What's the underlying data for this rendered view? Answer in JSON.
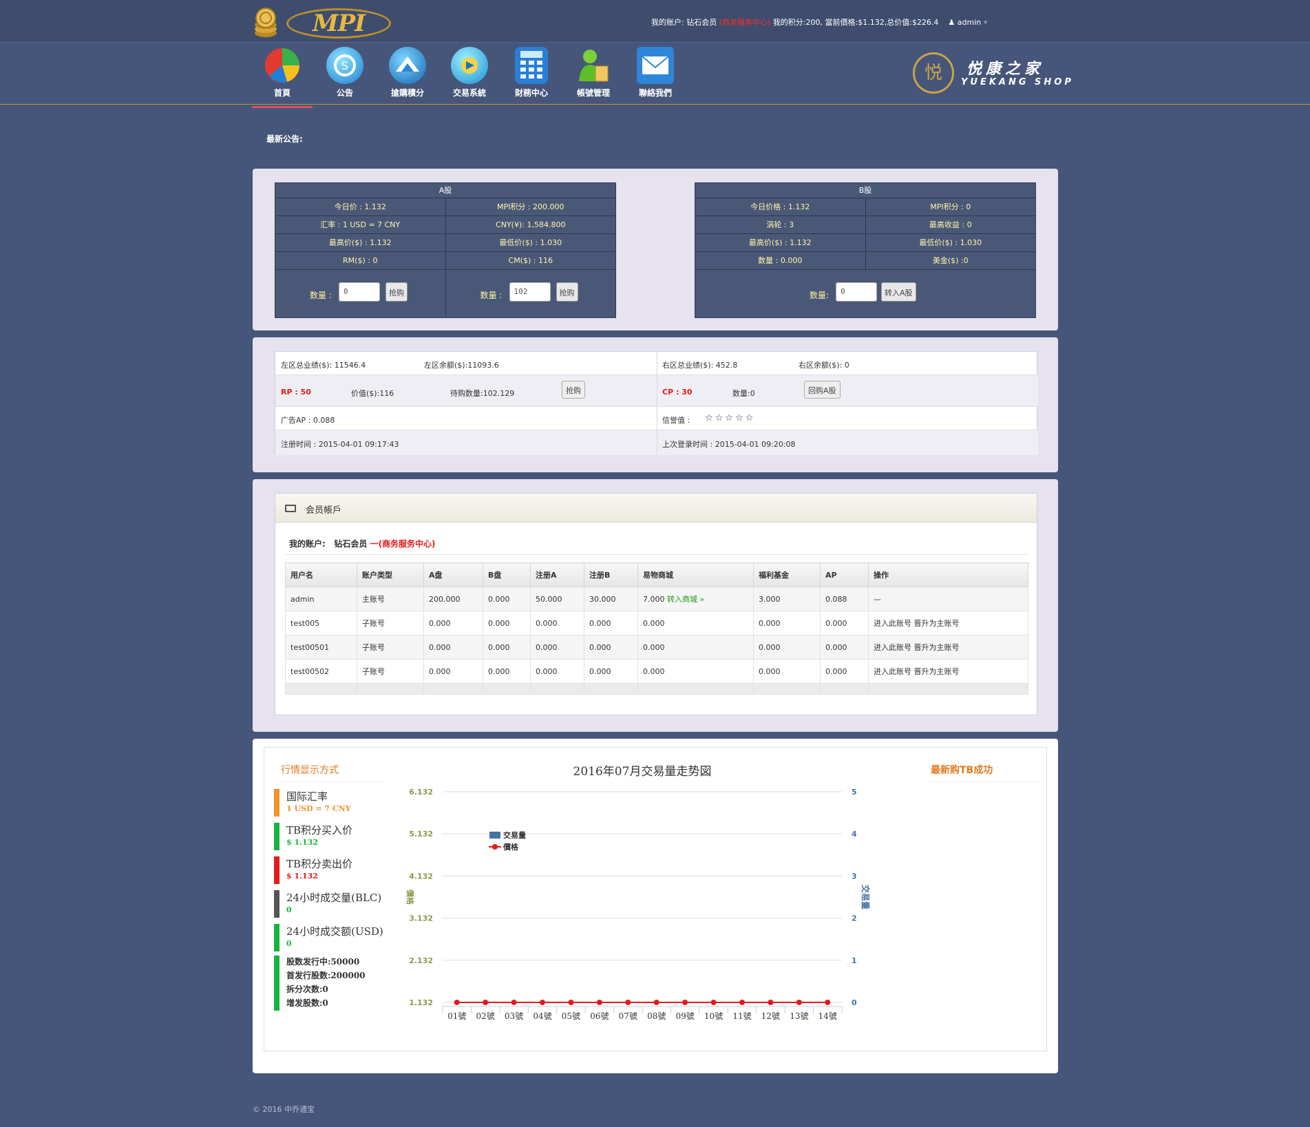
{
  "header": {
    "logo_text": "MPI",
    "account_label": "我的账户:",
    "account_level": "钻石会员",
    "service_center": "(商务服务中心)",
    "points_text": "我的积分:200,",
    "price_text": "當前價格:$1.132,",
    "total_text": "总价值:$226.4",
    "username": "admin"
  },
  "nav": [
    {
      "label": "首頁",
      "icon": "pie-chart-icon",
      "active": true
    },
    {
      "label": "公告",
      "icon": "announcement-icon"
    },
    {
      "label": "搶購積分",
      "icon": "mountain-icon"
    },
    {
      "label": "交易系統",
      "icon": "exchange-icon"
    },
    {
      "label": "財務中心",
      "icon": "calculator-icon"
    },
    {
      "label": "帳號管理",
      "icon": "user-icon"
    },
    {
      "label": "聯絡我們",
      "icon": "mail-icon"
    }
  ],
  "brand": {
    "cn": "悦康之家",
    "en": "YUEKANG SHOP"
  },
  "notice_label": "最新公告:",
  "stock_a": {
    "title": "A股",
    "rows": [
      [
        "今日价 : 1.132",
        "MPI积分 : 200.000"
      ],
      [
        "汇率 : 1 USD = 7 CNY",
        "CNY(¥): 1,584.800"
      ],
      [
        "最高价($) : 1.132",
        "最低价($) : 1.030"
      ],
      [
        "RM($) : 0",
        "CM($) : 116"
      ]
    ],
    "qty_label": "数量",
    "buy_left_value": "0",
    "buy_right_value": "102",
    "buy_btn": "抢购"
  },
  "stock_b": {
    "title": "B股",
    "rows": [
      [
        "今日价格 : 1.132",
        "MPI积分 : 0"
      ],
      [
        "涡轮 : 3",
        "最高收益 : 0"
      ],
      [
        "最高价($) : 1.132",
        "最低价($) : 1.030"
      ],
      [
        "数量 : 0.000",
        "美金($) :0"
      ]
    ],
    "qty_label": "数量",
    "qty_value": "0",
    "transfer_btn": "转入A股"
  },
  "info": {
    "left_total": "左区总业绩($): 11546.4",
    "left_balance": "左区余额($):11093.6",
    "right_total": "右区总业绩($): 452.8",
    "right_balance": "右区余额($): 0",
    "rp": "RP : 50",
    "value": "价值($):116",
    "pending": "待购数量:102.129",
    "buy_btn": "抢购",
    "cp": "CP : 30",
    "qty": "数量:0",
    "buyback_btn": "回购A股",
    "ad_ap": "广告AP : 0.088",
    "credit_label": "信誉值 :",
    "credit_stars": "☆☆☆☆☆",
    "reg_time": "注册时间 : 2015-04-01 09:17:43",
    "last_login": "上次登录时间 : 2015-04-01 09:20:08"
  },
  "member": {
    "title": "会员帳戶",
    "account_label": "我的账户:",
    "account_level": "钻石会员",
    "service": "一(商务服务中心)",
    "columns": [
      "用户名",
      "账户类型",
      "A盘",
      "B盘",
      "注册A",
      "注册B",
      "易物商城",
      "福利基金",
      "AP",
      "操作"
    ],
    "rows": [
      {
        "user": "admin",
        "type": "主账号",
        "a": "200.000",
        "b": "0.000",
        "ra": "50.000",
        "rb": "30.000",
        "mall": "7.000",
        "mall_link": "转入商城 »",
        "fund": "3.000",
        "ap": "0.088",
        "op": "—"
      },
      {
        "user": "test005",
        "type": "子账号",
        "a": "0.000",
        "b": "0.000",
        "ra": "0.000",
        "rb": "0.000",
        "mall": "0.000",
        "mall_link": "",
        "fund": "0.000",
        "ap": "0.000",
        "op": "进入此账号 晋升为主账号"
      },
      {
        "user": "test00501",
        "type": "子账号",
        "a": "0.000",
        "b": "0.000",
        "ra": "0.000",
        "rb": "0.000",
        "mall": "0.000",
        "mall_link": "",
        "fund": "0.000",
        "ap": "0.000",
        "op": "进入此账号 晋升为主账号"
      },
      {
        "user": "test00502",
        "type": "子账号",
        "a": "0.000",
        "b": "0.000",
        "ra": "0.000",
        "rb": "0.000",
        "mall": "0.000",
        "mall_link": "",
        "fund": "0.000",
        "ap": "0.000",
        "op": "进入此账号 晋升为主账号"
      }
    ]
  },
  "market": {
    "title": "行情显示方式",
    "items": [
      {
        "label": "国际汇率",
        "value": "1 USD = 7 CNY",
        "bar": "#f0932a",
        "vcolor": "#f0932a"
      },
      {
        "label": "TB积分买入价",
        "value": "$ 1.132",
        "bar": "#17b340",
        "vcolor": "#17b340"
      },
      {
        "label": "TB积分卖出价",
        "value": "$ 1.132",
        "bar": "#e51b1b",
        "vcolor": "#e51b1b"
      },
      {
        "label": "24小时成交量(BLC)",
        "value": "0",
        "bar": "#555555",
        "vcolor": "#17b340"
      },
      {
        "label": "24小时成交额(USD)",
        "value": "0",
        "bar": "#17b340",
        "vcolor": "#17b340"
      }
    ],
    "stats": [
      "股数发行中:50000",
      "首发行股数:200000",
      "拆分次数:0",
      "增发股数:0"
    ],
    "latest_title": "最新购TB成功"
  },
  "chart_data": {
    "type": "line",
    "title": "2016年07月交易量走势図",
    "categories": [
      "01號",
      "02號",
      "03號",
      "04號",
      "05號",
      "06號",
      "07號",
      "08號",
      "09號",
      "10號",
      "11號",
      "12號",
      "13號",
      "14號"
    ],
    "ylabel": "價格",
    "y2label": "交易量",
    "ylim": [
      1.132,
      6.132
    ],
    "y2lim": [
      0,
      5
    ],
    "yticks": [
      "6.132",
      "5.132",
      "4.132",
      "3.132",
      "2.132",
      "1.132"
    ],
    "y2ticks": [
      "5",
      "4",
      "3",
      "2",
      "1",
      "0"
    ],
    "series": [
      {
        "name": "交易量",
        "type": "bar",
        "color": "#4572a7",
        "values": [
          0,
          0,
          0,
          0,
          0,
          0,
          0,
          0,
          0,
          0,
          0,
          0,
          0,
          0
        ]
      },
      {
        "name": "價格",
        "type": "line",
        "color": "#e51b1b",
        "values": [
          1.132,
          1.132,
          1.132,
          1.132,
          1.132,
          1.132,
          1.132,
          1.132,
          1.132,
          1.132,
          1.132,
          1.132,
          1.132,
          1.132
        ]
      }
    ],
    "legend": "top-left",
    "grid": true
  },
  "footer": {
    "copyright": "© 2016 中乔通宝"
  }
}
